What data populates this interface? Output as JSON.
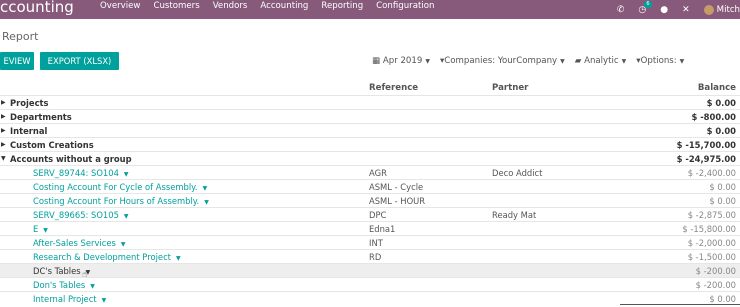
{
  "navbar": {
    "brand": "ccounting",
    "menu": [
      "Overview",
      "Customers",
      "Vendors",
      "Accounting",
      "Reporting",
      "Configuration"
    ],
    "notifications": "6",
    "user": "Mitch"
  },
  "page": {
    "title": "Report",
    "review_label": "EVIEW",
    "export_label": "EXPORT (XLSX)"
  },
  "filters": {
    "date": "Apr 2019",
    "companies": "Companies: YourCompany",
    "analytic": "Analytic",
    "options": "Options:"
  },
  "table": {
    "headers": {
      "reference": "Reference",
      "partner": "Partner",
      "balance": "Balance"
    },
    "groups": [
      {
        "name": "Projects",
        "balance": "$ 0.00"
      },
      {
        "name": "Departments",
        "balance": "$ -800.00"
      },
      {
        "name": "Internal",
        "balance": "$ 0.00"
      },
      {
        "name": "Custom Creations",
        "balance": "$ -15,700.00"
      },
      {
        "name": "Accounts without a group",
        "balance": "$ -24,975.00"
      }
    ],
    "accounts": [
      {
        "name": "SERV_89744: SO104",
        "reference": "AGR",
        "partner": "Deco Addict",
        "balance": "$ -2,400.00"
      },
      {
        "name": "Costing Account For Cycle of Assembly.",
        "reference": "ASML - Cycle",
        "partner": "",
        "balance": "$ 0.00"
      },
      {
        "name": "Costing Account For Hours of Assembly.",
        "reference": "ASML - HOUR",
        "partner": "",
        "balance": "$ 0.00"
      },
      {
        "name": "SERV_89665: SO105",
        "reference": "DPC",
        "partner": "Ready Mat",
        "balance": "$ -2,875.00"
      },
      {
        "name": "E",
        "reference": "Edna1",
        "partner": "",
        "balance": "$ -15,800.00"
      },
      {
        "name": "After-Sales Services",
        "reference": "INT",
        "partner": "",
        "balance": "$ -2,000.00"
      },
      {
        "name": "Research & Development Project",
        "reference": "RD",
        "partner": "",
        "balance": "$ -1,500.00"
      },
      {
        "name": "DC's Tables",
        "reference": "",
        "partner": "",
        "balance": "$ -200.00"
      },
      {
        "name": "Don's Tables",
        "reference": "",
        "partner": "",
        "balance": "$ -200.00"
      },
      {
        "name": "Internal Project",
        "reference": "",
        "partner": "",
        "balance": "$ 0.00"
      }
    ]
  }
}
